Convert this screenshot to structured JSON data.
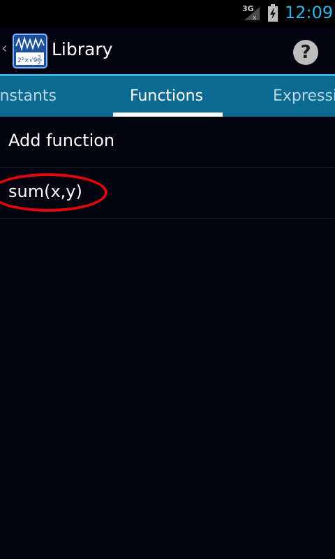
{
  "status_bar": {
    "network_type": "3G",
    "signal_icon": "signal-icon",
    "battery_icon": "battery-charging-icon",
    "time": "12:09",
    "time_color": "#33b5e5"
  },
  "action_bar": {
    "up_icon": "chevron-left-icon",
    "app_icon": "calculator-app-icon",
    "title": "Library",
    "help_label": "?"
  },
  "tabs": [
    {
      "label": "onstants",
      "selected": false
    },
    {
      "label": "Functions",
      "selected": true
    },
    {
      "label": "Expressi",
      "selected": false
    }
  ],
  "list": {
    "items": [
      {
        "label": "Add function"
      },
      {
        "label": "sum(x,y)",
        "annotated": true
      }
    ]
  },
  "colors": {
    "background": "#03030f",
    "tab_bar": "#0c6a91",
    "accent": "#33b5e5",
    "annotation": "#e3060c"
  }
}
